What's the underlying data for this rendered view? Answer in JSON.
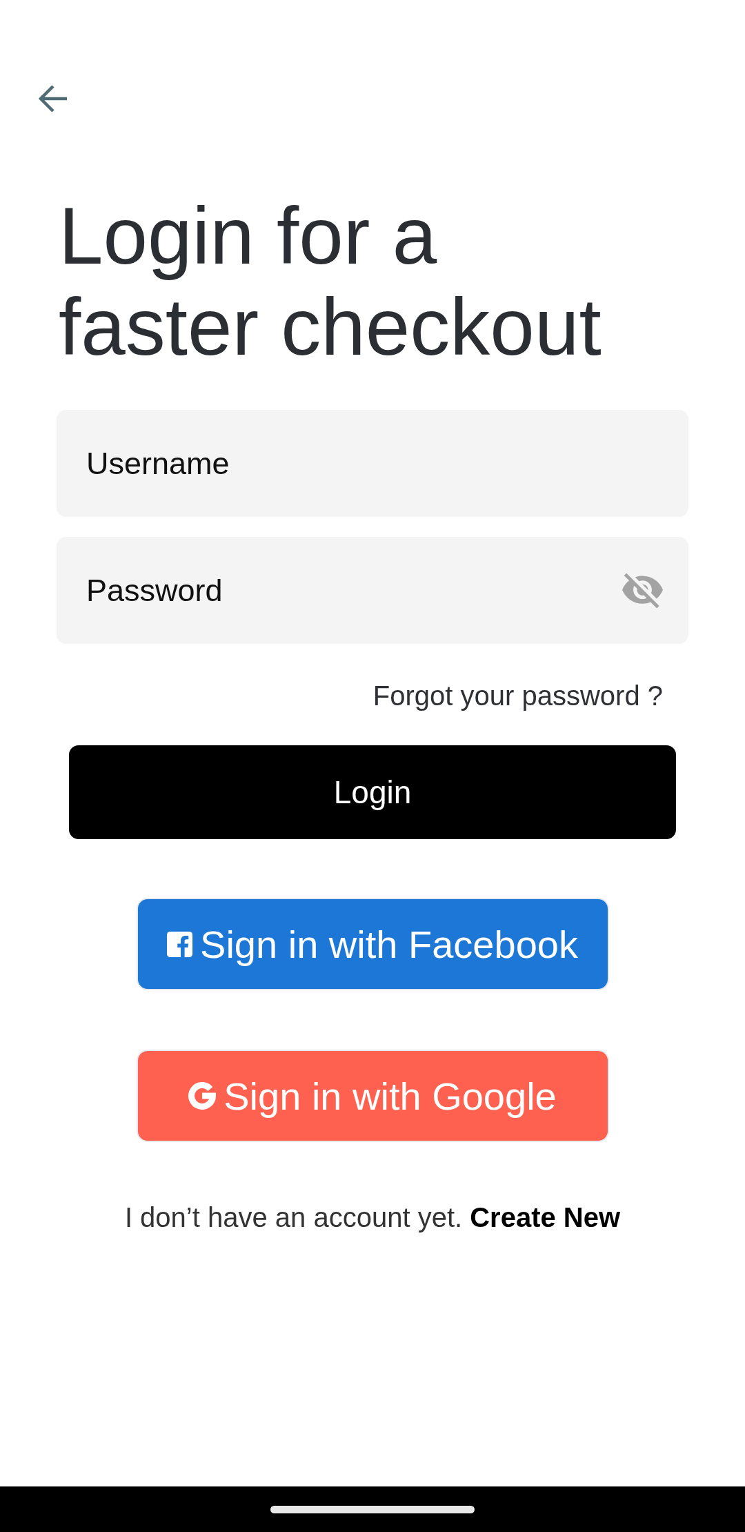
{
  "title": "Login for a faster checkout",
  "fields": [
    {
      "kind": "username",
      "placeholder": "Username"
    },
    {
      "kind": "password",
      "placeholder": "Password",
      "show_password": false
    }
  ],
  "forgot_password_link": "Forgot your password ?",
  "login_button": "Login",
  "social_buttons": [
    {
      "kind": "facebook",
      "label": "Sign in with Facebook",
      "color": "#1d77d6"
    },
    {
      "kind": "google",
      "label": "Sign in with Google",
      "color": "#fe6150"
    }
  ],
  "signup_prompt": {
    "text": "I don’t have an account yet.",
    "link": "Create New"
  }
}
